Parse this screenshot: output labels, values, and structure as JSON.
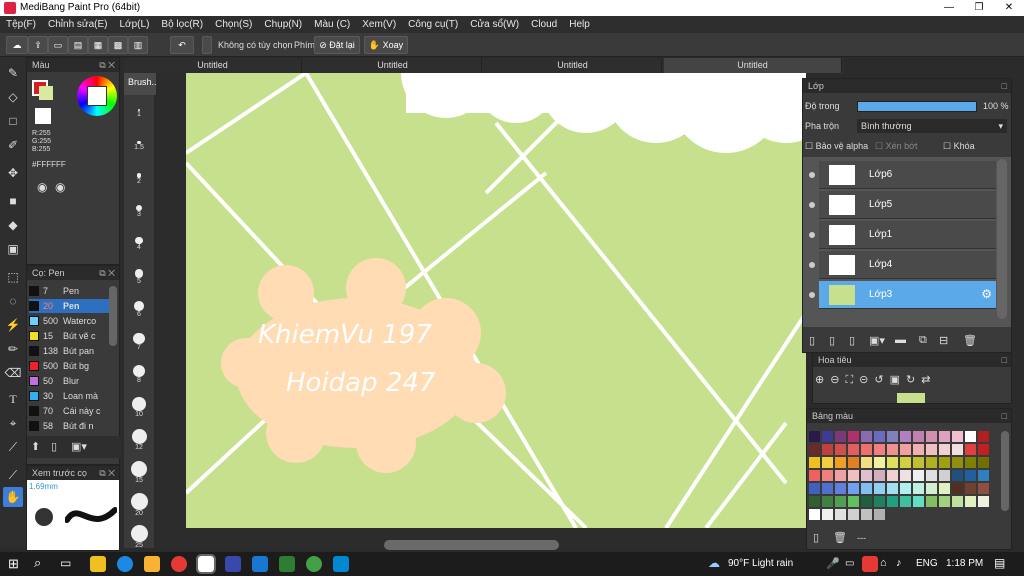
{
  "window": {
    "title": "MediBang Paint Pro (64bit)",
    "minimize": "—",
    "maximize": "❐",
    "close": "✕"
  },
  "menu": [
    "Tệp(F)",
    "Chỉnh sửa(E)",
    "Lớp(L)",
    "Bộ lọc(R)",
    "Chọn(S)",
    "Chụp(N)",
    "Màu (C)",
    "Xem(V)",
    "Công cụ(T)",
    "Cửa sổ(W)",
    "Cloud",
    "Help"
  ],
  "toolbar": {
    "selection": "Không có tùy chọn",
    "key_label": "Phím",
    "reset": "Đặt lại",
    "rotate": "Xoay"
  },
  "tabs": [
    "Untitled",
    "Untitled",
    "Untitled",
    "Untitled"
  ],
  "color_panel": {
    "title": "Màu",
    "r": "R:255",
    "g": "G:255",
    "b": "B:255",
    "hex": "#FFFFFF"
  },
  "brush_panel": {
    "title": "Cọ: Pen",
    "items": [
      {
        "size": "7",
        "name": "Pen",
        "color": "#111111"
      },
      {
        "size": "20",
        "name": "Pen",
        "color": "#111111",
        "selected": true
      },
      {
        "size": "500",
        "name": "Waterco",
        "color": "#6ad0ff"
      },
      {
        "size": "15",
        "name": "Bút vẽ c",
        "color": "#f0e020"
      },
      {
        "size": "138",
        "name": "Bút pan",
        "color": "#111111"
      },
      {
        "size": "500",
        "name": "Bút bg",
        "color": "#ee2222"
      },
      {
        "size": "50",
        "name": "Blur",
        "color": "#c070e0"
      },
      {
        "size": "30",
        "name": "Loan mà",
        "color": "#30b0f0"
      },
      {
        "size": "70",
        "name": "Cái này c",
        "color": "#111111"
      },
      {
        "size": "58",
        "name": "Bút đi n",
        "color": "#111111"
      }
    ]
  },
  "preview_panel": {
    "title": "Xem trước cọ",
    "size": "1.69mm"
  },
  "brush_sizes": [
    "1",
    "1.5",
    "2",
    "3",
    "4",
    "5",
    "6",
    "7",
    "8",
    "10",
    "12",
    "15",
    "20",
    "25"
  ],
  "brush_strip_title": "Brush...",
  "canvas": {
    "text1": "KhiemVu 197",
    "text2": "Hoidap 247",
    "bg": "#c6e08e",
    "blob": "#ffdcb4"
  },
  "layer_panel": {
    "title": "Lớp",
    "opacity_label": "Độ trong",
    "opacity_value": "100 %",
    "opacity": 1.0,
    "blend_label": "Pha trộn",
    "blend_value": "Bình thường",
    "alpha_label": "Bảo vệ alpha",
    "clip_label": "Xén bớt",
    "lock_label": "Khóa",
    "layers": [
      {
        "name": "Lớp6"
      },
      {
        "name": "Lớp5"
      },
      {
        "name": "Lớp1"
      },
      {
        "name": "Lớp4"
      },
      {
        "name": "Lớp3",
        "selected": true
      }
    ]
  },
  "nav_panel": {
    "title": "Hoa tiêu"
  },
  "palette_panel": {
    "title": "Bảng màu",
    "footer": "---"
  },
  "taskbar": {
    "weather": "90°F  Light rain",
    "lang": "ENG",
    "time": "1:18 PM"
  }
}
